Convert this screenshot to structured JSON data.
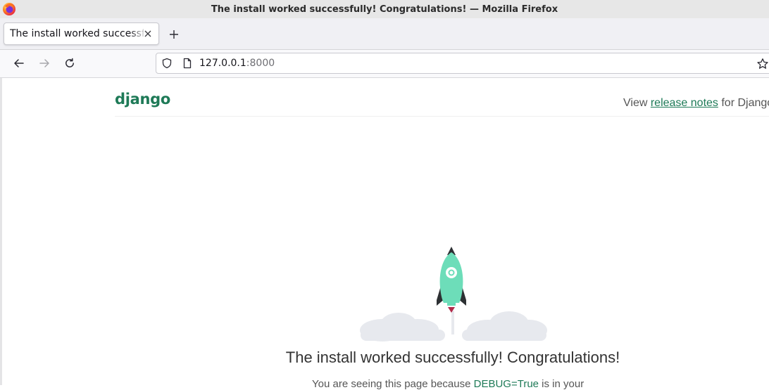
{
  "window": {
    "title": "The install worked successfully! Congratulations! — Mozilla Firefox"
  },
  "tabs": [
    {
      "label": "The install worked successfully! Congratulations!",
      "active": true
    }
  ],
  "navbar": {
    "url_host": "127.0.0.1",
    "url_port": ":8000"
  },
  "page": {
    "logo": "django",
    "release_prefix": "View ",
    "release_link": "release notes",
    "release_suffix": " for Django",
    "headline": "The install worked successfully! Congratulations!",
    "subline_prefix": "You are seeing this page because ",
    "subline_code": "DEBUG=True",
    "subline_suffix": " is in your"
  },
  "colors": {
    "django_green": "#1e7a57",
    "rocket_body": "#6dddb9",
    "rocket_fin": "#2d3033",
    "rocket_flame": "#b12a4a",
    "clouds": "#e7e9ee"
  },
  "icons": {
    "app": "firefox-logo-icon",
    "close": "close-icon",
    "newtab": "plus-icon",
    "back": "arrow-left-icon",
    "forward": "arrow-right-icon",
    "reload": "reload-icon",
    "shield": "shield-icon",
    "page": "page-icon",
    "bookmark": "star-icon"
  }
}
